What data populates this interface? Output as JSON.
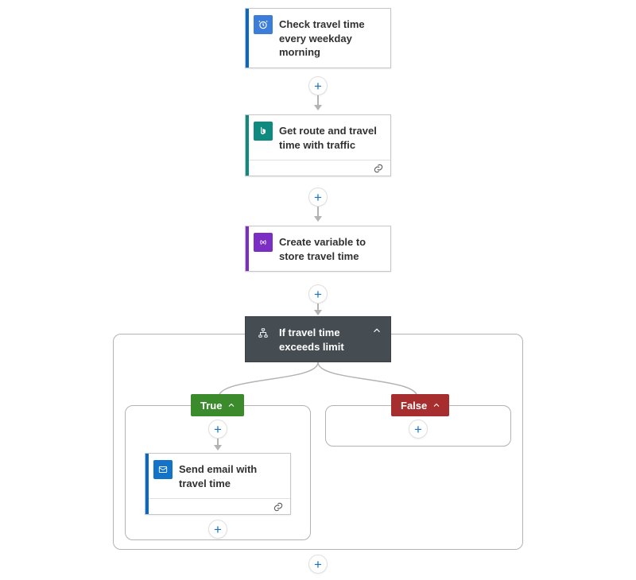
{
  "steps": {
    "trigger": {
      "label": "Check travel time every weekday morning",
      "accent": "#0769c3",
      "iconbg": "#3b7dd8"
    },
    "route": {
      "label": "Get route and travel time with traffic",
      "accent": "#0f8a7e",
      "iconbg": "#0f8a7e"
    },
    "variable": {
      "label": "Create variable to store travel time",
      "accent": "#7b2ec4",
      "iconbg": "#7b2ec4"
    },
    "condition": {
      "label": "If travel time exceeds limit"
    },
    "email": {
      "label": "Send email with travel time",
      "accent": "#0769c3",
      "iconbg": "#1273c9"
    }
  },
  "branches": {
    "true": {
      "label": "True",
      "color": "#3b8b2c"
    },
    "false": {
      "label": "False",
      "color": "#a72e2e"
    }
  }
}
